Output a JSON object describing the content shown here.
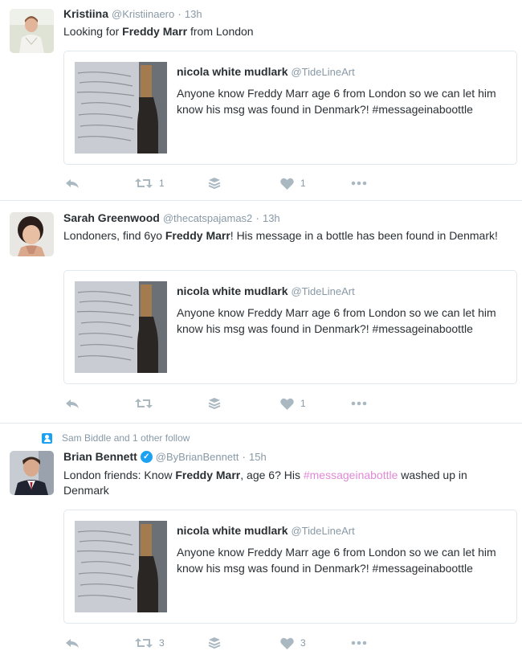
{
  "tweets": [
    {
      "name": "Kristiina",
      "handle": "@Kristiinaero",
      "time": "13h",
      "text_parts": [
        "Looking for ",
        "Freddy Marr",
        " from London"
      ],
      "quote": {
        "name": "nicola white mudlark",
        "handle": "@TideLineArt",
        "text": "Anyone know Freddy Marr age 6 from London so we can let him know his msg was found in Denmark?! #messageinaboottle"
      },
      "actions": {
        "retweets": "1",
        "likes": "1"
      }
    },
    {
      "name": "Sarah Greenwood",
      "handle": "@thecatspajamas2",
      "time": "13h",
      "text_parts": [
        "Londoners, find 6yo ",
        "Freddy Marr",
        "! His message in a bottle has been found in Denmark!"
      ],
      "quote": {
        "name": "nicola white mudlark",
        "handle": "@TideLineArt",
        "text": "Anyone know Freddy Marr age 6 from London so we can let him know his msg was found in Denmark?! #messageinaboottle"
      },
      "actions": {
        "retweets": "",
        "likes": "1"
      }
    },
    {
      "context": "Sam Biddle and 1 other follow",
      "name": "Brian Bennett",
      "handle": "@ByBrianBennett",
      "time": "15h",
      "text_parts": [
        "London friends: Know ",
        "Freddy Marr",
        ", age 6? His ",
        "#messageinabottle",
        " washed up in Denmark"
      ],
      "quote": {
        "name": "nicola white mudlark",
        "handle": "@TideLineArt",
        "text": "Anyone know Freddy Marr age 6 from London so we can let him know his msg was found in Denmark?! #messageinaboottle"
      },
      "actions": {
        "retweets": "3",
        "likes": "3"
      }
    }
  ],
  "colors": {
    "text": "#292f33",
    "muted": "#8899a6",
    "icon": "#aab8c2",
    "border": "#e1e8ed",
    "hashtag": "#e08ad6",
    "verified": "#1da1f2"
  },
  "icons": [
    "reply-icon",
    "retweet-icon",
    "stack-icon",
    "heart-icon",
    "more-icon",
    "verified-icon",
    "follow-context-icon"
  ]
}
